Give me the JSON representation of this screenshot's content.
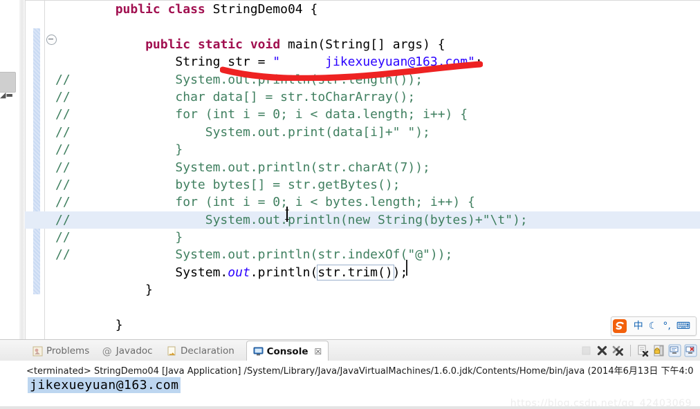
{
  "editor": {
    "language": "java",
    "lines": [
      {
        "id": "line-class-decl",
        "comment": "",
        "indent": 0,
        "text": "public class StringDemo04 {",
        "highlight": false
      },
      {
        "id": "line-blank-1",
        "comment": "",
        "indent": 0,
        "text": "",
        "highlight": false
      },
      {
        "id": "line-main-decl",
        "comment": "",
        "indent": 1,
        "text": "public static void main(String[] args) {",
        "highlight": false
      },
      {
        "id": "line-string-decl",
        "comment": "",
        "indent": 2,
        "text": "String str = \"      jikexueyuan@163.com\";",
        "highlight": false
      },
      {
        "id": "line-println-length",
        "comment": "//",
        "indent": 2,
        "text": "System.out.println(str.length());",
        "highlight": false
      },
      {
        "id": "line-char-data",
        "comment": "//",
        "indent": 2,
        "text": "char data[] = str.toCharArray();",
        "highlight": false
      },
      {
        "id": "line-for-data",
        "comment": "//",
        "indent": 2,
        "text": "for (int i = 0; i < data.length; i++) {",
        "highlight": false
      },
      {
        "id": "line-print-data",
        "comment": "//",
        "indent": 3,
        "text": "System.out.print(data[i]+\" \");",
        "highlight": false
      },
      {
        "id": "line-close-for-data",
        "comment": "//",
        "indent": 2,
        "text": "}",
        "highlight": false
      },
      {
        "id": "line-println-charat",
        "comment": "//",
        "indent": 2,
        "text": "System.out.println(str.charAt(7));",
        "highlight": false
      },
      {
        "id": "line-byte-bytes",
        "comment": "//",
        "indent": 2,
        "text": "byte bytes[] = str.getBytes();",
        "highlight": false
      },
      {
        "id": "line-for-bytes",
        "comment": "//",
        "indent": 2,
        "text": "for (int i = 0; i < bytes.length; i++) {",
        "highlight": false
      },
      {
        "id": "line-println-newstring",
        "comment": "//",
        "indent": 3,
        "text": "System.out.println(new String(bytes)+\"\\t\");",
        "highlight": true
      },
      {
        "id": "line-close-for-bytes",
        "comment": "//",
        "indent": 2,
        "text": "}",
        "highlight": false
      },
      {
        "id": "line-println-indexof",
        "comment": "//",
        "indent": 2,
        "text": "System.out.println(str.indexOf(\"@\"));",
        "highlight": false
      },
      {
        "id": "line-println-trim",
        "comment": "",
        "indent": 2,
        "text": "System.out.println(str.trim());",
        "highlight": false
      },
      {
        "id": "line-close-main",
        "comment": "",
        "indent": 1,
        "text": "}",
        "highlight": false
      },
      {
        "id": "line-blank-2",
        "comment": "",
        "indent": 0,
        "text": "",
        "highlight": false
      },
      {
        "id": "line-close-class",
        "comment": "",
        "indent": 0,
        "text": "}",
        "highlight": false
      }
    ],
    "boxed_token": "str.trim()",
    "annotation": {
      "type": "red-underline",
      "color": "#ee2222"
    },
    "colors": {
      "keyword": "#a11050",
      "comment": "#3f7f5f",
      "string": "#2a00ff",
      "field": "#2a00ff",
      "line_highlight": "#e4ecf8",
      "change_bar": "#c6d8f2"
    }
  },
  "ime": {
    "logo_label": "S",
    "items": [
      {
        "name": "language-mode",
        "label": "中"
      },
      {
        "name": "moon-mode",
        "label": "☾"
      },
      {
        "name": "punctuation",
        "label": "°,"
      },
      {
        "name": "soft-keyboard",
        "label": "⌨"
      }
    ]
  },
  "bottom_panel": {
    "tabs": [
      {
        "id": "tab-problems",
        "label": "Problems",
        "icon": "problems-icon",
        "active": false,
        "closable": false
      },
      {
        "id": "tab-javadoc",
        "label": "Javadoc",
        "icon": "javadoc-icon",
        "active": false,
        "closable": false
      },
      {
        "id": "tab-declaration",
        "label": "Declaration",
        "icon": "declaration-icon",
        "active": false,
        "closable": false
      },
      {
        "id": "tab-console",
        "label": "Console",
        "icon": "console-icon",
        "active": true,
        "closable": true
      }
    ],
    "close_glyph": "☒",
    "toolbar_buttons": [
      {
        "id": "terminate-button",
        "icon": "stop-square-icon",
        "enabled": false
      },
      {
        "id": "remove-launch-button",
        "icon": "remove-x-icon",
        "enabled": true
      },
      {
        "id": "remove-all-button",
        "icon": "remove-all-xx-icon",
        "enabled": true
      },
      {
        "id": "clear-console-button",
        "icon": "clear-console-icon",
        "enabled": true
      },
      {
        "id": "scroll-lock-button",
        "icon": "lock-icon",
        "enabled": true
      },
      {
        "id": "pin-console-button",
        "icon": "pin-console-icon",
        "enabled": true
      },
      {
        "id": "display-console-button",
        "icon": "display-console-icon",
        "enabled": true
      }
    ],
    "console": {
      "terminated_line": "<terminated> StringDemo04 [Java Application] /System/Library/Java/JavaVirtualMachines/1.6.0.jdk/Contents/Home/bin/java (2014年6月13日 下午4:0",
      "output": "jikexueyuan@163.com",
      "output_selected": true,
      "selection_color": "#bdd6f0"
    }
  },
  "watermark": {
    "text": "https://blog.csdn.net/qq_42403069"
  }
}
